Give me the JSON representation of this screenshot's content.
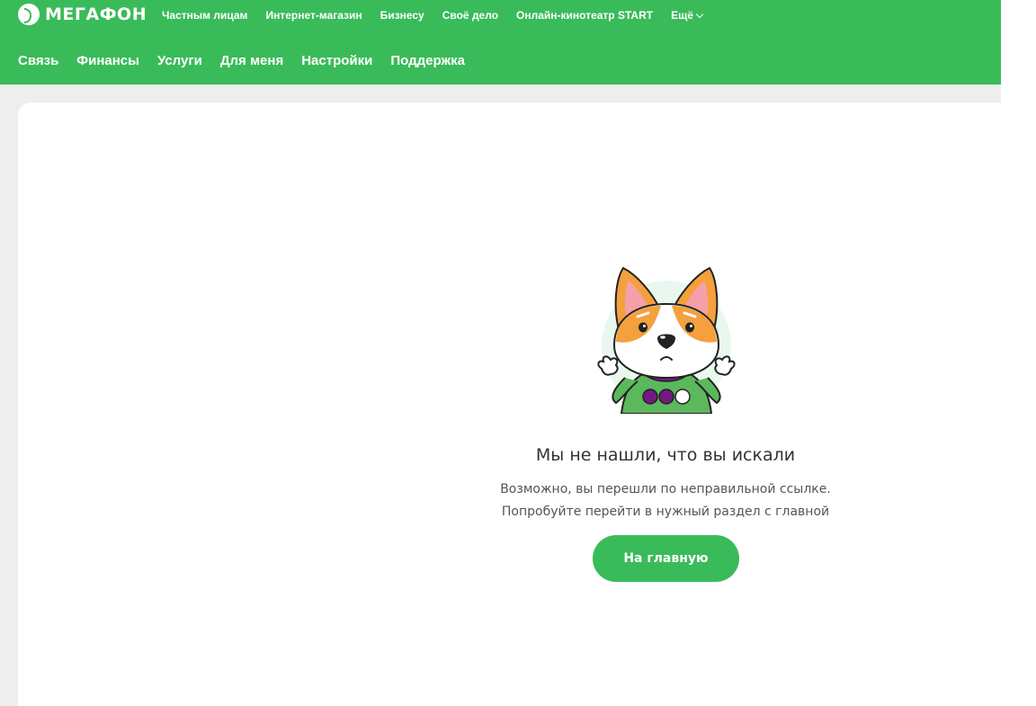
{
  "brand": {
    "name": "МЕГАФОН",
    "color": "#3abb5a"
  },
  "topnav": {
    "items": [
      "Частным лицам",
      "Интернет-магазин",
      "Бизнесу",
      "Своё дело",
      "Онлайн-кинотеатр START"
    ],
    "more_label": "Ещё"
  },
  "mainnav": {
    "items": [
      "Связь",
      "Финансы",
      "Услуги",
      "Для меня",
      "Настройки",
      "Поддержка"
    ]
  },
  "error": {
    "title": "Мы не нашли, что вы искали",
    "line1": "Возможно, вы перешли по неправильной ссылке.",
    "line2": "Попробуйте перейти в нужный раздел с главной",
    "button_label": "На главную",
    "illustration": "corgi-shrug-illustration"
  }
}
